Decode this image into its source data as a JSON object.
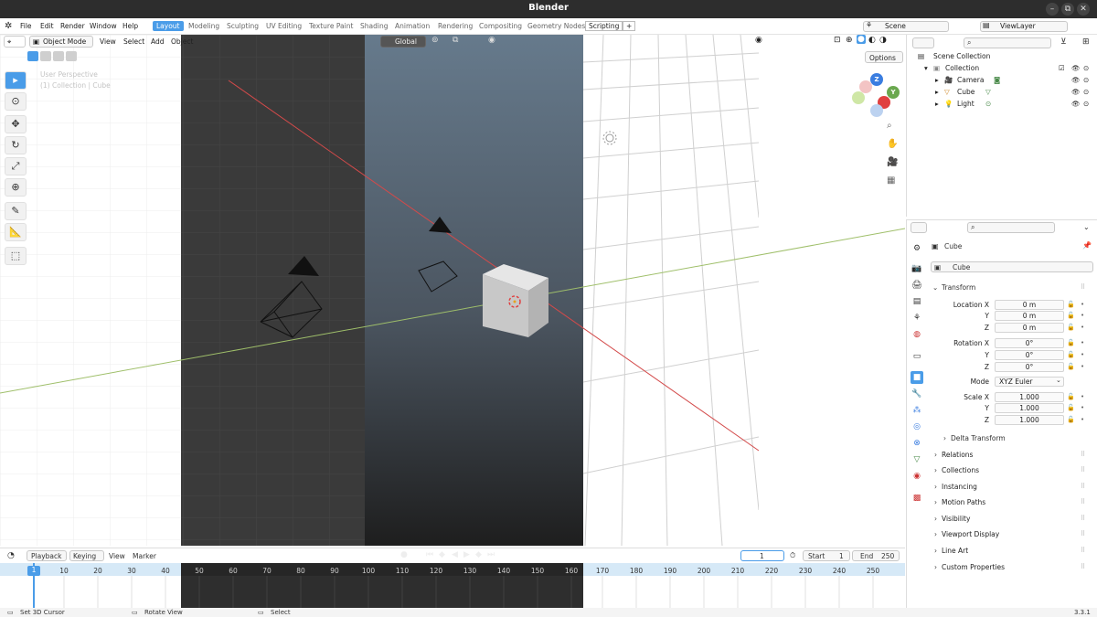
{
  "window": {
    "title": "Blender",
    "minimize": "–",
    "maximize": "⧉",
    "close": "✕"
  },
  "menu": {
    "items": [
      "File",
      "Edit",
      "Render",
      "Window",
      "Help"
    ]
  },
  "workspaces": {
    "active": "Layout",
    "tabs": [
      "Modeling",
      "Sculpting",
      "UV Editing",
      "Texture Paint",
      "Shading",
      "Animation",
      "Rendering",
      "Compositing",
      "Geometry Nodes",
      "Scripting"
    ],
    "add": "+"
  },
  "scene": {
    "name": "Scene",
    "view_layer": "ViewLayer"
  },
  "viewport_header": {
    "mode": "Object Mode",
    "menus": [
      "View",
      "Select",
      "Add",
      "Object"
    ],
    "orientation": "Global",
    "options": "Options"
  },
  "overlay_text": {
    "perspective": "User Perspective",
    "collection": "(1) Collection | Cube"
  },
  "outliner": {
    "root": "Scene Collection",
    "collection": "Collection",
    "objects": [
      "Camera",
      "Cube",
      "Light"
    ]
  },
  "properties": {
    "object_name": "Cube",
    "data_name": "Cube",
    "transform_title": "Transform",
    "location_label": "Location X",
    "rotation_label": "Rotation X",
    "scale_label": "Scale X",
    "axis_y": "Y",
    "axis_z": "Z",
    "location": [
      "0 m",
      "0 m",
      "0 m"
    ],
    "rotation": [
      "0°",
      "0°",
      "0°"
    ],
    "scale": [
      "1.000",
      "1.000",
      "1.000"
    ],
    "mode_label": "Mode",
    "mode_value": "XYZ Euler",
    "delta": "Delta Transform",
    "sections": [
      "Relations",
      "Collections",
      "Instancing",
      "Motion Paths",
      "Visibility",
      "Viewport Display",
      "Line Art",
      "Custom Properties"
    ]
  },
  "timeline": {
    "menus": [
      "Playback",
      "Keying",
      "View",
      "Marker"
    ],
    "current_frame": "1",
    "start_label": "Start",
    "start": "1",
    "end_label": "End",
    "end": "250",
    "ticks": [
      "10",
      "20",
      "30",
      "40",
      "50",
      "60",
      "70",
      "80",
      "90",
      "100",
      "110",
      "120",
      "130",
      "140",
      "150",
      "160",
      "170",
      "180",
      "190",
      "200",
      "210",
      "220",
      "230",
      "240",
      "250"
    ],
    "playhead": "1"
  },
  "status": {
    "left": "Set 3D Cursor",
    "mid": "Rotate View",
    "right_action": "Select",
    "version": "3.3.1"
  },
  "colors": {
    "accent": "#4a9ce8",
    "axis_red": "#e04040",
    "axis_green": "#6aa84f",
    "axis_blue": "#3a7de0"
  }
}
